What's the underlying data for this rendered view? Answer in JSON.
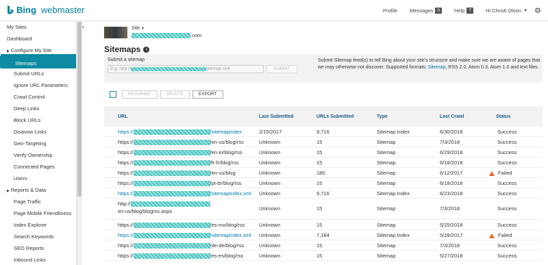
{
  "header": {
    "brand": "Bing",
    "product": "webmaster",
    "nav": {
      "profile": "Profile",
      "messages": "Messages",
      "messages_count": "0",
      "help": "Help",
      "help_count": "7",
      "user": "Hi Christi Olson"
    },
    "icons": [
      "bing-logo-icon",
      "chevron-down-icon",
      "gear-icon"
    ]
  },
  "sidebar": {
    "items": [
      {
        "label": "My Sites",
        "level": 0
      },
      {
        "label": "Dashboard",
        "level": 0
      },
      {
        "label": "Configure My Site",
        "level": 0,
        "expandable": true
      },
      {
        "label": "Sitemaps",
        "level": 1,
        "active": true
      },
      {
        "label": "Submit URLs",
        "level": 1
      },
      {
        "label": "Ignore URL Parameters",
        "level": 1
      },
      {
        "label": "Crawl Control",
        "level": 1
      },
      {
        "label": "Deep Links",
        "level": 1
      },
      {
        "label": "Block URLs",
        "level": 1
      },
      {
        "label": "Disavow Links",
        "level": 1
      },
      {
        "label": "Geo-Targeting",
        "level": 1
      },
      {
        "label": "Verify Ownership",
        "level": 1
      },
      {
        "label": "Connected Pages",
        "level": 1
      },
      {
        "label": "Users",
        "level": 1
      },
      {
        "label": "Reports & Data",
        "level": 0,
        "expandable": true
      },
      {
        "label": "Page Traffic",
        "level": 1
      },
      {
        "label": "Page Mobile Friendliness",
        "level": 1
      },
      {
        "label": "Index Explorer",
        "level": 1
      },
      {
        "label": "Search Keywords",
        "level": 1
      },
      {
        "label": "SEO Reports",
        "level": 1
      },
      {
        "label": "Inbound Links",
        "level": 1
      }
    ],
    "collapse_glyph": "‹"
  },
  "site": {
    "label": "Site",
    "domain_suffix": ".com"
  },
  "page": {
    "title": "Sitemaps"
  },
  "submit": {
    "label": "Submit a sitemap",
    "placeholder_prefix": "E.g. http://",
    "placeholder_suffix": "sitemap.xml",
    "button": "SUBMIT",
    "desc_before": "Submit Sitemap feed(s) to tell Bing about your site's structure and make sure we are aware of pages that we may otherwise not discover. Supported formats: ",
    "desc_link": "Sitemap",
    "desc_after": ", RSS 2.0, Atom 0.3, Atom 1.0 and text files."
  },
  "actions": {
    "resubmit": "RESUBMIT",
    "delete": "DELETE",
    "export": "EXPORT"
  },
  "table": {
    "headers": {
      "url": "URL",
      "last_submitted": "Last Submitted",
      "urls_submitted": "URLs Submitted",
      "type": "Type",
      "last_crawl": "Last Crawl",
      "status": "Status"
    },
    "rows": [
      {
        "prefix": "https://",
        "path": "/sitemapindex",
        "link": true,
        "last_submitted": "2/15/2017",
        "urls": "9,716",
        "type": "Sitemap Index",
        "last_crawl": "6/30/2018",
        "status": "Success",
        "warn": false
      },
      {
        "prefix": "https://",
        "path": "/en-us/blog/rss",
        "link": false,
        "last_submitted": "Unknown",
        "urls": "15",
        "type": "Sitemap",
        "last_crawl": "7/3/2018",
        "status": "Success",
        "warn": false
      },
      {
        "prefix": "https://",
        "path": "/en-in/blog/rss",
        "link": false,
        "last_submitted": "Unknown",
        "urls": "15",
        "type": "Sitemap",
        "last_crawl": "6/29/2018",
        "status": "Success",
        "warn": false
      },
      {
        "prefix": "https://",
        "path": "/fr-fr/blog/rss",
        "link": false,
        "last_submitted": "Unknown",
        "urls": "15",
        "type": "Sitemap",
        "last_crawl": "6/18/2018",
        "status": "Success",
        "warn": false
      },
      {
        "prefix": "https://",
        "path": "/en-us/blog",
        "link": false,
        "last_submitted": "Unknown",
        "urls": "180",
        "type": "Sitemap",
        "last_crawl": "6/12/2017",
        "status": "Failed",
        "warn": true
      },
      {
        "prefix": "https://",
        "path": "/pt-br/blog/rss",
        "link": false,
        "last_submitted": "Unknown",
        "urls": "15",
        "type": "Sitemap",
        "last_crawl": "6/18/2018",
        "status": "Success",
        "warn": false
      },
      {
        "prefix": "https://",
        "path": "/sitemapIndex.xml",
        "link": true,
        "last_submitted": "Unknown",
        "urls": "9,716",
        "type": "Sitemap Index",
        "last_crawl": "6/23/2018",
        "status": "Success",
        "warn": false
      },
      {
        "prefix": "http://",
        "path": "en-us/blog/blogrss.aspx",
        "link": false,
        "last_submitted": "Unknown",
        "urls": "15",
        "type": "Sitemap",
        "last_crawl": "7/3/2018",
        "status": "Success",
        "warn": false,
        "tall": true
      },
      {
        "prefix": "https://",
        "path": "/es-mx/blog/rss",
        "link": false,
        "last_submitted": "Unknown",
        "urls": "15",
        "type": "Sitemap",
        "last_crawl": "5/25/2018",
        "status": "Success",
        "warn": false
      },
      {
        "prefix": "https://",
        "path": "/sitemapindex.xml",
        "link": true,
        "last_submitted": "Unknown",
        "urls": "7,164",
        "type": "Sitemap Index",
        "last_crawl": "5/28/2017",
        "status": "Failed",
        "warn": true
      },
      {
        "prefix": "https://",
        "path": "/de-de/blog/rss",
        "link": false,
        "last_submitted": "Unknown",
        "urls": "15",
        "type": "Sitemap",
        "last_crawl": "7/3/2018",
        "status": "Success",
        "warn": false
      },
      {
        "prefix": "https://",
        "path": "/es-es/blog/rss",
        "link": false,
        "last_submitted": "Unknown",
        "urls": "15",
        "type": "Sitemap",
        "last_crawl": "5/27/2018",
        "status": "Success",
        "warn": false
      }
    ]
  },
  "colors": {
    "accent": "#0e8aa3",
    "brand": "#00809d",
    "link": "#0078a8",
    "warning": "#e8632b",
    "redaction": "#4cc6c1"
  }
}
